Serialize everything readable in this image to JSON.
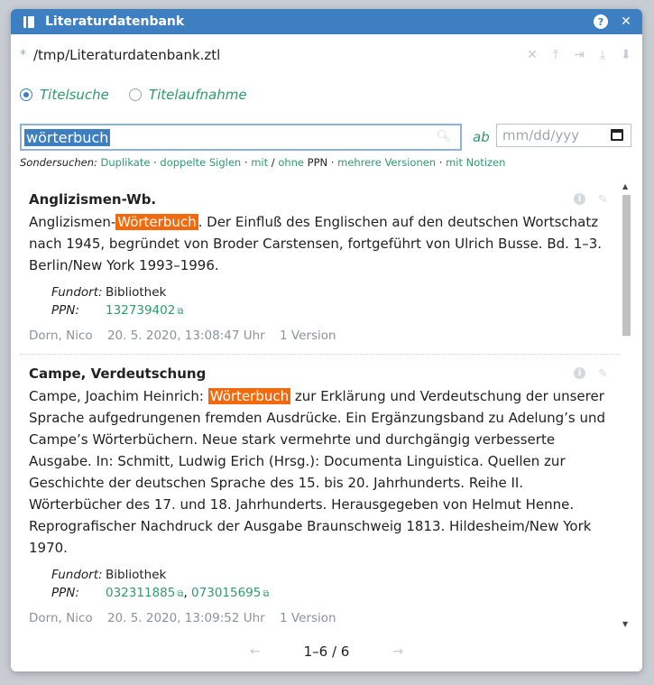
{
  "window": {
    "title": "Literaturdatenbank",
    "help_icon": "?",
    "close_icon": "✕"
  },
  "file": {
    "modified_marker": "*",
    "path": "/tmp/Literaturdatenbank.ztl"
  },
  "modes": [
    {
      "label": "Titelsuche",
      "selected": true
    },
    {
      "label": "Titelaufnahme",
      "selected": false
    }
  ],
  "search": {
    "value": "wörterbuch",
    "ab_label": "ab",
    "date_placeholder": "mm/dd/yyy"
  },
  "special": {
    "label": "Sondersuchen:",
    "items": [
      "Duplikate",
      "doppelte Siglen",
      "mit",
      "ohne",
      "PPN",
      "mehrere Versionen",
      "mit Notizen"
    ]
  },
  "entries": [
    {
      "title": "Anglizismen-Wb.",
      "pre": "Anglizismen-",
      "highlight": "Wörterbuch",
      "post": ". Der Einfluß des Englischen auf den deutschen Wortschatz nach 1945, begründet von Broder Carstensen, fortgeführt von Ulrich Busse. Bd. 1–3. Berlin/New York 1993–1996.",
      "fundort_label": "Fundort:",
      "fundort": "Bibliothek",
      "ppn_label": "PPN:",
      "ppn": [
        "132739402"
      ],
      "author": "Dorn, Nico",
      "date": "20. 5. 2020, 13:08:47 Uhr",
      "versions": "1 Version"
    },
    {
      "title": "Campe, Verdeutschung",
      "pre": "Campe, Joachim Heinrich: ",
      "highlight": "Wörterbuch",
      "post": " zur Erklärung und Verdeutschung der unserer Sprache aufgedrungenen fremden Ausdrücke. Ein Ergänzungsband zu Adelung’s und Campe’s Wörterbüchern. Neue stark vermehrte und durchgängig verbesserte Ausgabe. In: Schmitt, Ludwig Erich (Hrsg.): Documenta Linguistica. Quellen zur Geschichte der deutschen Sprache des 15. bis 20. Jahrhunderts. Reihe II. Wörterbücher des 17. und 18. Jahrhunderts. Herausgegeben von Helmut Henne. Reprografischer Nachdruck der Ausgabe Braunschweig 1813. Hildesheim/New York 1970.",
      "fundort_label": "Fundort:",
      "fundort": "Bibliothek",
      "ppn_label": "PPN:",
      "ppn": [
        "032311885",
        "073015695"
      ],
      "author": "Dorn, Nico",
      "date": "20. 5. 2020, 13:09:52 Uhr",
      "versions": "1 Version"
    }
  ],
  "pager": {
    "text": "1–6 / 6"
  }
}
